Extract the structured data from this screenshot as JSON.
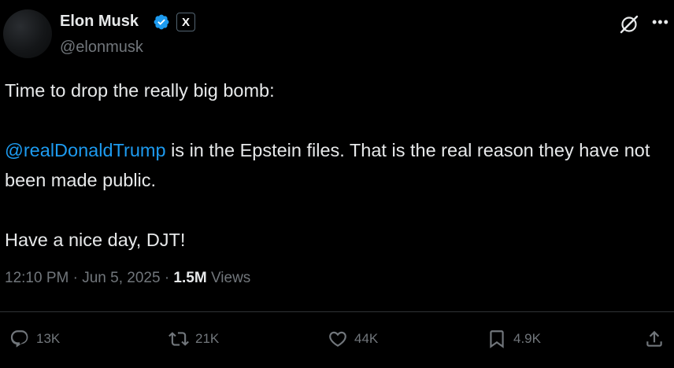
{
  "author": {
    "name": "Elon Musk",
    "handle": "@elonmusk",
    "avatar_icon": "avatar",
    "verified_icon": "verified-badge-icon",
    "affiliation_icon": "x-logo-icon",
    "affiliation_label": "X"
  },
  "tweet": {
    "line1": "Time to drop the really big bomb:",
    "mention": "@realDonaldTrump",
    "line2_rest": " is in the Epstein files. That is the real reason they have not been made public.",
    "line3": "Have a nice day, DJT!"
  },
  "meta": {
    "time": "12:10 PM",
    "separator": "·",
    "date": "Jun 5, 2025",
    "views_count": "1.5M",
    "views_label": "Views"
  },
  "actions": {
    "replies": "13K",
    "reposts": "21K",
    "likes": "44K",
    "bookmarks": "4.9K"
  },
  "colors": {
    "background": "#000000",
    "text": "#e7e9ea",
    "secondary": "#71767b",
    "accent": "#1d9bf0",
    "divider": "#2f3336"
  }
}
